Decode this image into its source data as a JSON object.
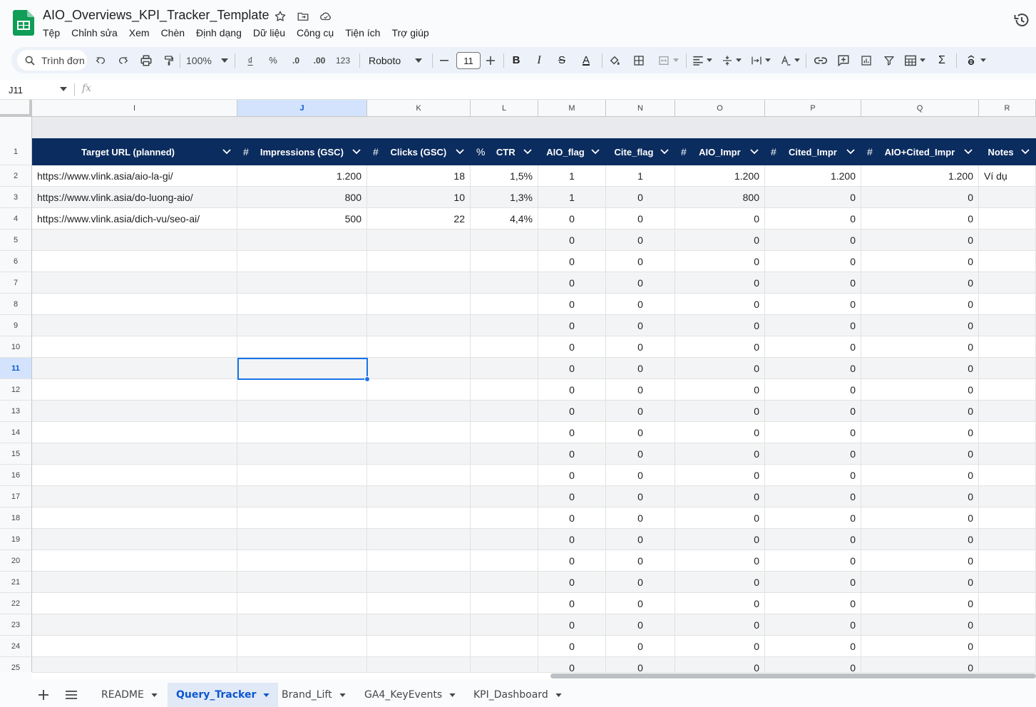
{
  "app": {
    "doc_title": "AIO_Overviews_KPI_Tracker_Template",
    "menu": [
      "Tệp",
      "Chỉnh sửa",
      "Xem",
      "Chèn",
      "Định dạng",
      "Dữ liệu",
      "Công cụ",
      "Tiện ích",
      "Trợ giúp"
    ],
    "brand_color": "#0f9d58",
    "accent_color": "#0b57d0"
  },
  "toolbar": {
    "search_label": "Trình đơn",
    "zoom": "100%",
    "currency": "₫",
    "percent": "%",
    "dec_decrease": ".0",
    "dec_increase": ".00",
    "format_123": "123",
    "font_name": "Roboto",
    "font_size": "11",
    "bold": "B",
    "italic": "I",
    "strike": "S",
    "text_color": "A",
    "sum": "Σ",
    "icons": [
      "search-icon",
      "undo-icon",
      "redo-icon",
      "print-icon",
      "paint-format-icon",
      "fill-color-icon",
      "borders-icon",
      "merge-icon",
      "align-icon",
      "valign-icon",
      "wrap-icon",
      "rotate-icon",
      "link-icon",
      "comment-icon",
      "chart-icon",
      "filter-icon",
      "table-view-icon",
      "functions-icon",
      "input-tools-icon"
    ]
  },
  "formula_bar": {
    "name_box": "J11",
    "fx": "fx",
    "value": ""
  },
  "columns": [
    {
      "letter": "I",
      "header": "Target URL (planned)",
      "prefix": "",
      "align": "l"
    },
    {
      "letter": "J",
      "header": "Impressions (GSC)",
      "prefix": "#",
      "align": "r"
    },
    {
      "letter": "K",
      "header": "Clicks (GSC)",
      "prefix": "#",
      "align": "r"
    },
    {
      "letter": "L",
      "header": "CTR",
      "prefix": "%",
      "align": "r"
    },
    {
      "letter": "M",
      "header": "AIO_flag",
      "prefix": "",
      "align": "c"
    },
    {
      "letter": "N",
      "header": "Cite_flag",
      "prefix": "",
      "align": "c"
    },
    {
      "letter": "O",
      "header": "AIO_Impr",
      "prefix": "#",
      "align": "r"
    },
    {
      "letter": "P",
      "header": "Cited_Impr",
      "prefix": "#",
      "align": "r"
    },
    {
      "letter": "Q",
      "header": "AIO+Cited_Impr",
      "prefix": "#",
      "align": "r"
    },
    {
      "letter": "R",
      "header": "Notes",
      "prefix": "",
      "align": "l"
    }
  ],
  "rows": [
    {
      "n": "2",
      "cells": [
        "https://www.vlink.asia/aio-la-gi/",
        "1.200",
        "18",
        "1,5%",
        "1",
        "1",
        "1.200",
        "1.200",
        "1.200",
        "Ví dụ"
      ]
    },
    {
      "n": "3",
      "cells": [
        "https://www.vlink.asia/do-luong-aio/",
        "800",
        "10",
        "1,3%",
        "1",
        "0",
        "800",
        "0",
        "0",
        ""
      ]
    },
    {
      "n": "4",
      "cells": [
        "https://www.vlink.asia/dich-vu/seo-ai/",
        "500",
        "22",
        "4,4%",
        "0",
        "0",
        "0",
        "0",
        "0",
        ""
      ]
    },
    {
      "n": "5",
      "cells": [
        "",
        "",
        "",
        "",
        "0",
        "0",
        "0",
        "0",
        "0",
        ""
      ]
    },
    {
      "n": "6",
      "cells": [
        "",
        "",
        "",
        "",
        "0",
        "0",
        "0",
        "0",
        "0",
        ""
      ]
    },
    {
      "n": "7",
      "cells": [
        "",
        "",
        "",
        "",
        "0",
        "0",
        "0",
        "0",
        "0",
        ""
      ]
    },
    {
      "n": "8",
      "cells": [
        "",
        "",
        "",
        "",
        "0",
        "0",
        "0",
        "0",
        "0",
        ""
      ]
    },
    {
      "n": "9",
      "cells": [
        "",
        "",
        "",
        "",
        "0",
        "0",
        "0",
        "0",
        "0",
        ""
      ]
    },
    {
      "n": "10",
      "cells": [
        "",
        "",
        "",
        "",
        "0",
        "0",
        "0",
        "0",
        "0",
        ""
      ]
    },
    {
      "n": "11",
      "cells": [
        "",
        "",
        "",
        "",
        "0",
        "0",
        "0",
        "0",
        "0",
        ""
      ]
    },
    {
      "n": "12",
      "cells": [
        "",
        "",
        "",
        "",
        "0",
        "0",
        "0",
        "0",
        "0",
        ""
      ]
    },
    {
      "n": "13",
      "cells": [
        "",
        "",
        "",
        "",
        "0",
        "0",
        "0",
        "0",
        "0",
        ""
      ]
    },
    {
      "n": "14",
      "cells": [
        "",
        "",
        "",
        "",
        "0",
        "0",
        "0",
        "0",
        "0",
        ""
      ]
    },
    {
      "n": "15",
      "cells": [
        "",
        "",
        "",
        "",
        "0",
        "0",
        "0",
        "0",
        "0",
        ""
      ]
    },
    {
      "n": "16",
      "cells": [
        "",
        "",
        "",
        "",
        "0",
        "0",
        "0",
        "0",
        "0",
        ""
      ]
    },
    {
      "n": "17",
      "cells": [
        "",
        "",
        "",
        "",
        "0",
        "0",
        "0",
        "0",
        "0",
        ""
      ]
    },
    {
      "n": "18",
      "cells": [
        "",
        "",
        "",
        "",
        "0",
        "0",
        "0",
        "0",
        "0",
        ""
      ]
    },
    {
      "n": "19",
      "cells": [
        "",
        "",
        "",
        "",
        "0",
        "0",
        "0",
        "0",
        "0",
        ""
      ]
    },
    {
      "n": "20",
      "cells": [
        "",
        "",
        "",
        "",
        "0",
        "0",
        "0",
        "0",
        "0",
        ""
      ]
    },
    {
      "n": "21",
      "cells": [
        "",
        "",
        "",
        "",
        "0",
        "0",
        "0",
        "0",
        "0",
        ""
      ]
    },
    {
      "n": "22",
      "cells": [
        "",
        "",
        "",
        "",
        "0",
        "0",
        "0",
        "0",
        "0",
        ""
      ]
    },
    {
      "n": "23",
      "cells": [
        "",
        "",
        "",
        "",
        "0",
        "0",
        "0",
        "0",
        "0",
        ""
      ]
    },
    {
      "n": "24",
      "cells": [
        "",
        "",
        "",
        "",
        "0",
        "0",
        "0",
        "0",
        "0",
        ""
      ]
    },
    {
      "n": "25",
      "cells": [
        "",
        "",
        "",
        "",
        "0",
        "0",
        "0",
        "0",
        "0",
        ""
      ]
    }
  ],
  "header_row_number": "1",
  "selected": {
    "column": "J",
    "row": "11"
  },
  "sheets": {
    "tabs": [
      "README",
      "Query_Tracker",
      "Brand_Lift",
      "GA4_KeyEvents",
      "KPI_Dashboard"
    ],
    "active": "Query_Tracker",
    "add_icon": "plus-icon",
    "list_icon": "sheet-list-icon"
  },
  "colors": {
    "header_fill": "#0b2c5e",
    "selection": "#1a73e8",
    "alt_row": "#f3f4f6"
  }
}
